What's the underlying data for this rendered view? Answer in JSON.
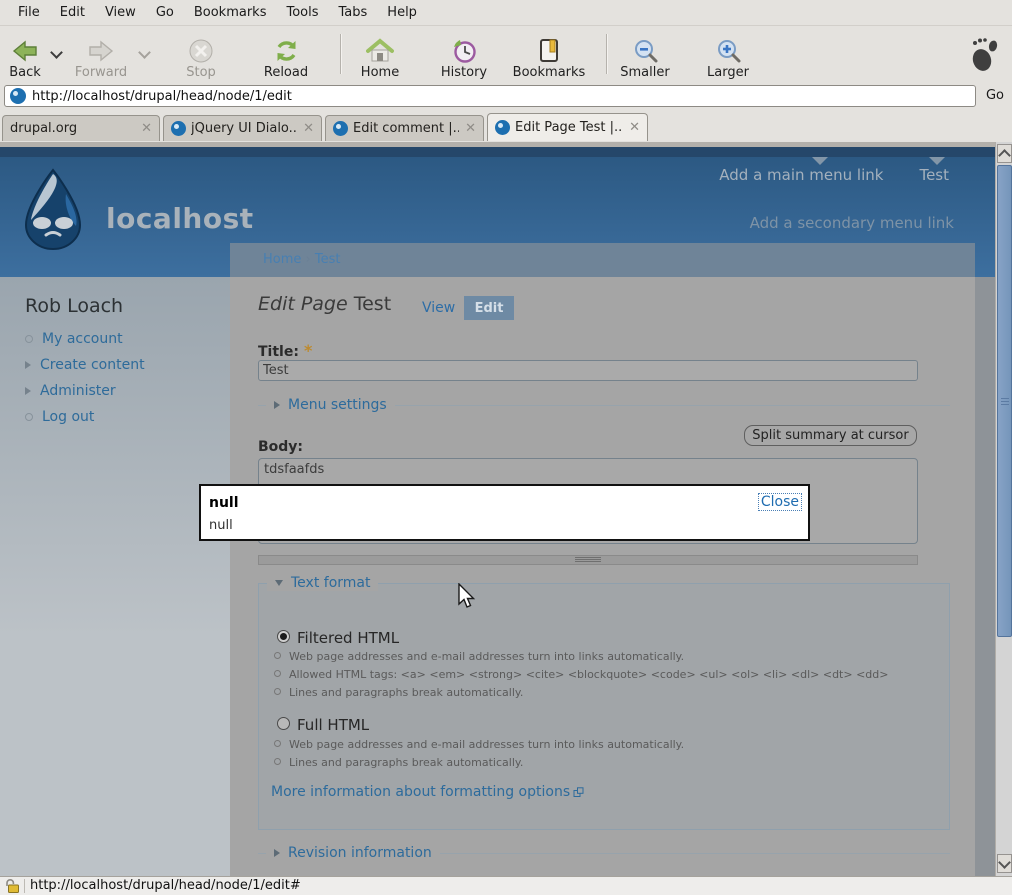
{
  "browser": {
    "menu_bar": [
      "File",
      "Edit",
      "View",
      "Go",
      "Bookmarks",
      "Tools",
      "Tabs",
      "Help"
    ],
    "toolbar": {
      "back_label": "Back",
      "forward_label": "Forward",
      "stop_label": "Stop",
      "reload_label": "Reload",
      "home_label": "Home",
      "history_label": "History",
      "bookmarks_label": "Bookmarks",
      "smaller_label": "Smaller",
      "larger_label": "Larger"
    },
    "address_bar": {
      "url": "http://localhost/drupal/head/node/1/edit",
      "go_label": "Go"
    },
    "tabs": [
      {
        "title": "drupal.org",
        "active": false
      },
      {
        "title": "jQuery UI Dialo...",
        "active": false
      },
      {
        "title": "Edit comment |...",
        "active": false
      },
      {
        "title": "Edit Page Test |...",
        "active": true
      }
    ],
    "status_bar": {
      "text": "http://localhost/drupal/head/node/1/edit#"
    }
  },
  "page": {
    "site_name": "localhost",
    "primary_links": [
      "Add a main menu link",
      "Test"
    ],
    "secondary_links": [
      "Add a secondary menu link"
    ],
    "breadcrumb": {
      "home": "Home",
      "sep": "›",
      "current": "Test"
    },
    "sidebar": {
      "user_name": "Rob Loach",
      "items": [
        {
          "label": "My account",
          "bullet": "circle"
        },
        {
          "label": "Create content",
          "bullet": "arrow"
        },
        {
          "label": "Administer",
          "bullet": "arrow"
        },
        {
          "label": "Log out",
          "bullet": "circle"
        }
      ]
    },
    "heading": {
      "italic": "Edit Page",
      "normal": "Test"
    },
    "tabs": {
      "view": "View",
      "edit": "Edit"
    },
    "form": {
      "title_label": "Title:",
      "required_marker": "*",
      "title_value": "Test",
      "menu_settings_label": "Menu settings",
      "body_label": "Body:",
      "split_button": "Split summary at cursor",
      "body_value": "tdsfaafds",
      "text_format_label": "Text format",
      "formats": [
        {
          "name": "Filtered HTML",
          "selected": true,
          "tips": [
            "Web page addresses and e-mail addresses turn into links automatically.",
            "Allowed HTML tags: <a> <em> <strong> <cite> <blockquote> <code> <ul> <ol> <li> <dl> <dt> <dd>",
            "Lines and paragraphs break automatically."
          ]
        },
        {
          "name": "Full HTML",
          "selected": false,
          "tips": [
            "Web page addresses and e-mail addresses turn into links automatically.",
            "Lines and paragraphs break automatically."
          ]
        }
      ],
      "more_info_link": "More information about formatting options",
      "revision_label": "Revision information"
    },
    "dialog": {
      "title": "null",
      "body": "null",
      "close_label": "Close"
    }
  },
  "colors": {
    "link_blue": "#2d6b9c",
    "header_blue": "#35689a",
    "required_marker": "#bd8a2f",
    "active_mini_tab": "#6e8aa4",
    "dialog_bg": "#ffffff"
  }
}
